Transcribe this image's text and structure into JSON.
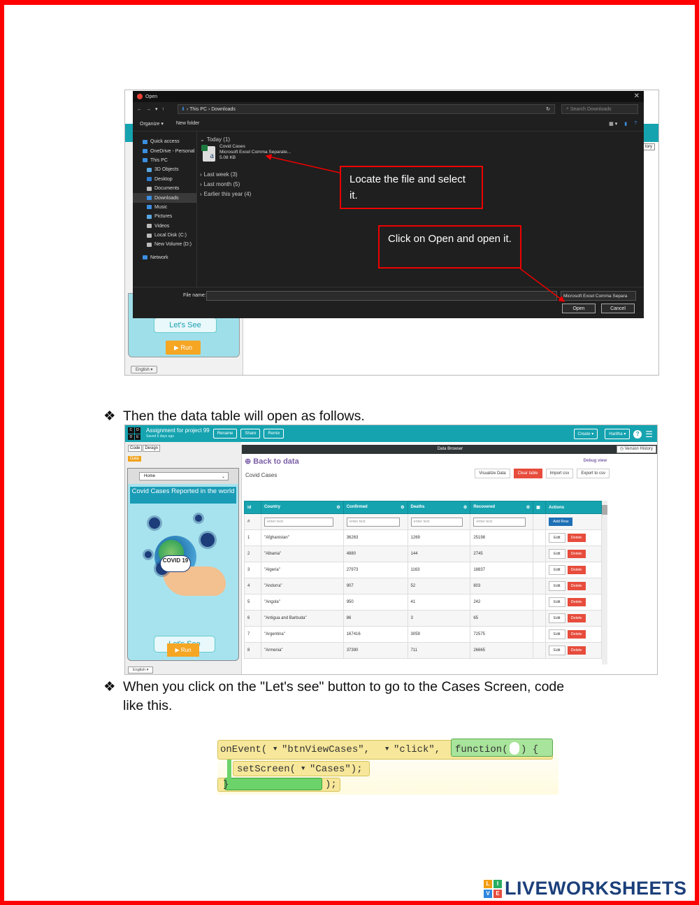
{
  "dialog": {
    "title": "Open",
    "breadcrumb": [
      "This PC",
      "Downloads"
    ],
    "search_placeholder": "Search Downloads",
    "toolbar": {
      "organize": "Organize ▾",
      "new_folder": "New folder"
    },
    "nav": [
      {
        "label": "Quick access",
        "color": "#3b8ee0"
      },
      {
        "label": "OneDrive - Personal",
        "color": "#3b8ee0"
      },
      {
        "label": "This PC",
        "color": "#3b8ee0"
      },
      {
        "label": "3D Objects",
        "color": "#59a7e0"
      },
      {
        "label": "Desktop",
        "color": "#2e7dd0"
      },
      {
        "label": "Documents",
        "color": "#bbbbbb"
      },
      {
        "label": "Downloads",
        "color": "#3b8ee0"
      },
      {
        "label": "Music",
        "color": "#3b8ee0"
      },
      {
        "label": "Pictures",
        "color": "#59a7e0"
      },
      {
        "label": "Videos",
        "color": "#bbbbbb"
      },
      {
        "label": "Local Disk (C:)",
        "color": "#bbbbbb"
      },
      {
        "label": "New Volume (D:)",
        "color": "#bbbbbb"
      },
      {
        "label": "Network",
        "color": "#3b8ee0"
      }
    ],
    "groups": {
      "today": "Today (1)",
      "last_week": "Last week (3)",
      "last_month": "Last month (5)",
      "earlier": "Earlier this year (4)"
    },
    "file": {
      "name": "Covid Cases",
      "type": "Microsoft Excel Comma Separate...",
      "size": "5.08 KB"
    },
    "file_name_label": "File name:",
    "file_type": "Microsoft Excel Comma Separa",
    "open_button": "Open",
    "cancel_button": "Cancel"
  },
  "callouts": {
    "locate": "Locate the file and select it.",
    "open": "Click on Open and open it."
  },
  "shot1_app": {
    "lets_see": "Let's See",
    "run": "Run",
    "language": "English",
    "history": "tory"
  },
  "text": {
    "line1": "Then the data table will open as follows.",
    "line2": "When you click on the \"Let's see\" button to go to the Cases Screen, code",
    "line2b": "like this."
  },
  "app": {
    "project_title": "Assignment for project 99",
    "saved": "Saved 6 days ago",
    "rename": "Rename",
    "share": "Share",
    "remix": "Remix",
    "create": "Create ▾",
    "user": "Haritha ▾",
    "code_tab": "Code",
    "design_tab": "Design",
    "data_tag": "Data",
    "home_select": "Home",
    "phone_title": "Covid Cases Reported in the world",
    "covid_label": "COVID 19",
    "lets_see": "Let's See",
    "run": "Run",
    "language": "English",
    "data_browser": "Data Browser",
    "version_history": "Version History",
    "back_to_data": "Back to data",
    "debug_view": "Debug view",
    "table_name": "Covid Cases",
    "visualize": "Visualize Data",
    "clear_table": "Clear table",
    "import_csv": "Import csv",
    "export_csv": "Export to csv"
  },
  "table": {
    "headers": [
      "id",
      "Country",
      "Confirmed",
      "Deaths",
      "Recovered",
      "",
      "Actions"
    ],
    "placeholder": "enter text",
    "add_row": "Add Row",
    "edit": "Edit",
    "delete": "Delete",
    "rows": [
      [
        "1",
        "\"Afghanistan\"",
        "36263",
        "1269",
        "25198"
      ],
      [
        "2",
        "\"Albania\"",
        "4880",
        "144",
        "2745"
      ],
      [
        "3",
        "\"Algeria\"",
        "27973",
        "1163",
        "18837"
      ],
      [
        "4",
        "\"Andorra\"",
        "907",
        "52",
        "803"
      ],
      [
        "5",
        "\"Angola\"",
        "950",
        "41",
        "242"
      ],
      [
        "6",
        "\"Antigua and Barbuda\"",
        "86",
        "3",
        "65"
      ],
      [
        "7",
        "\"Argentina\"",
        "167416",
        "3059",
        "72575"
      ],
      [
        "8",
        "\"Armenia\"",
        "37390",
        "711",
        "26665"
      ]
    ]
  },
  "code": {
    "on_event": "onEvent(",
    "btn": "\"btnViewCases\",",
    "click": "\"click\",",
    "function": "function(",
    "brace": ") {",
    "set_screen": "setScreen(",
    "cases": "\"Cases\");",
    "close_brace": "}",
    "close_paren": ");"
  },
  "footer": {
    "brand": "LIVEWORKSHEETS",
    "icon_letters": [
      "L",
      "I",
      "V",
      "E"
    ]
  },
  "colors": {
    "frame": "#ff0000",
    "teal": "#16a3b0",
    "callout_border": "#e00000",
    "brand": "#1b3f7a"
  }
}
